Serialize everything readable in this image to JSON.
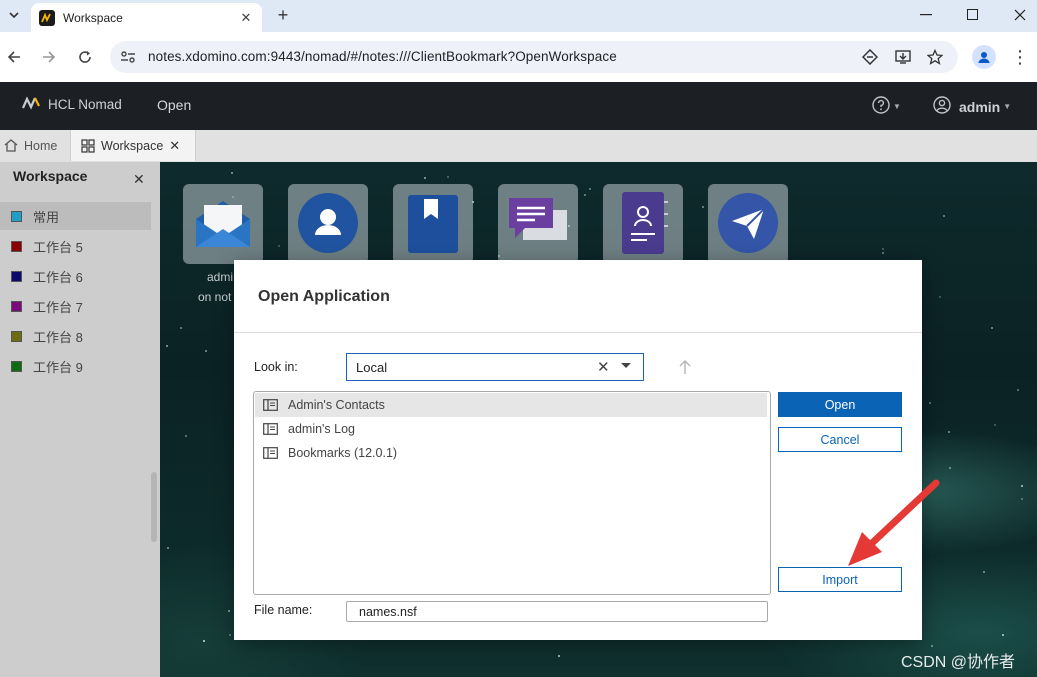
{
  "browser": {
    "tab_title": "Workspace",
    "url": "notes.xdomino.com:9443/nomad/#/notes:///ClientBookmark?OpenWorkspace"
  },
  "app": {
    "brand": "HCL Nomad",
    "menu_open": "Open",
    "user": "admin"
  },
  "app_tabs": [
    {
      "label": "Home"
    },
    {
      "label": "Workspace"
    }
  ],
  "sidebar": {
    "title": "Workspace",
    "items": [
      {
        "label": "常用",
        "color": "#1e9fc8"
      },
      {
        "label": "工作台 5",
        "color": "#8b0000"
      },
      {
        "label": "工作台 6",
        "color": "#0a0a6e"
      },
      {
        "label": "工作台 7",
        "color": "#7a0a7a"
      },
      {
        "label": "工作台 8",
        "color": "#6b6b10"
      },
      {
        "label": "工作台 9",
        "color": "#0e6b12"
      }
    ]
  },
  "workspace_icons": {
    "caption_line1": "admi",
    "caption_line2": "on not"
  },
  "dialog": {
    "title": "Open Application",
    "look_in_label": "Look in:",
    "look_in_value": "Local",
    "files": [
      {
        "name": "Admin's Contacts"
      },
      {
        "name": "admin's Log"
      },
      {
        "name": "Bookmarks (12.0.1)"
      }
    ],
    "open_label": "Open",
    "cancel_label": "Cancel",
    "import_label": "Import",
    "file_name_label": "File name:",
    "file_name_value": "names.nsf"
  },
  "watermark": "CSDN @协作者",
  "colors": {
    "accent": "#0b63b5",
    "appbar": "#1c1f23",
    "annotation_arrow": "#e53935"
  }
}
